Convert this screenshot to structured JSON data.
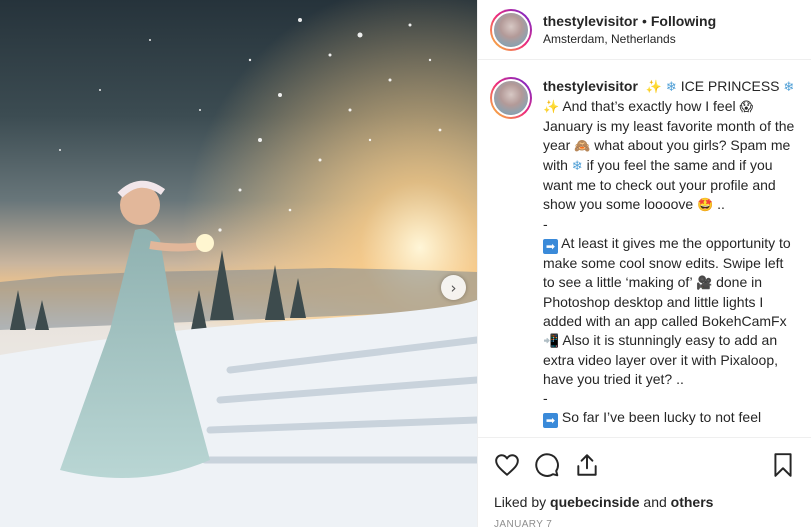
{
  "post": {
    "username": "thestylevisitor",
    "separator": "•",
    "follow_status": "Following",
    "location": "Amsterdam, Netherlands"
  },
  "caption": {
    "username": "thestylevisitor",
    "p1_title": "ICE PRINCESS",
    "p1_text_a": "And that’s exactly how I feel",
    "p1_text_b": "January is my least favorite month of the year",
    "p1_text_c": "what about you girls? Spam me with",
    "p1_text_d": "if you feel the same and if you want me to check out your profile and show you some loooove",
    "p1_text_e": "..",
    "dash1": "-",
    "p2_text_a": "At least it gives me the opportunity to make some cool snow edits. Swipe left to see a little ‘making of’",
    "p2_text_b": "done in Photoshop desktop and little lights I added with an app called BokehCamFx",
    "p2_text_c": "Also it is stunningly easy to add an extra video layer over it with Pixaloop, have you tried it yet? ..",
    "dash2": "-",
    "p3_text": "So far I’ve been lucky to not feel"
  },
  "icons": {
    "sparkles": "✨",
    "snowflake": "❄",
    "scream": "😱",
    "monkey": "🙈",
    "star_struck": "🤩",
    "arrow": "➡",
    "camera": "🎥",
    "phone": "📲",
    "next": "›"
  },
  "engagement": {
    "liked_by_prefix": "Liked by",
    "liked_by_user": "quebecinside",
    "liked_by_and": "and",
    "liked_by_others": "others",
    "date": "JANUARY 7"
  }
}
